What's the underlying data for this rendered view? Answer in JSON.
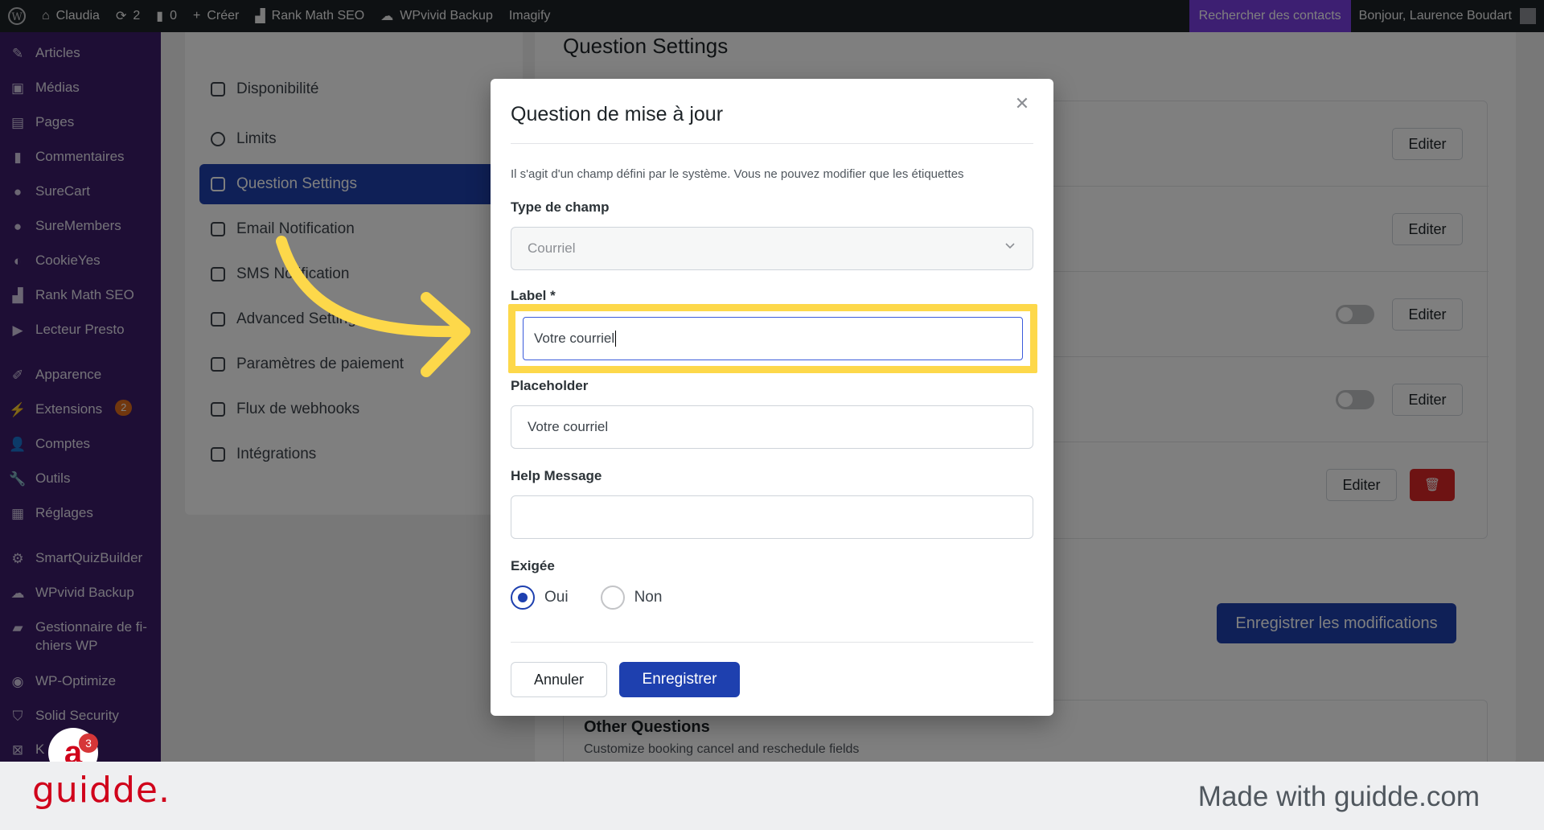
{
  "adminbar": {
    "site_name": "Claudia",
    "updates_count": "2",
    "comments_count": "0",
    "new_label": "Créer",
    "rankmath": "Rank Math SEO",
    "wpvivid": "WPvivid Backup",
    "imagify": "Imagify",
    "contacts": "Rechercher des contacts",
    "greeting": "Bonjour, Laurence Boudart"
  },
  "sidebar": {
    "items": [
      {
        "label": "Articles",
        "icon": "pin-icon"
      },
      {
        "label": "Médias",
        "icon": "media-icon"
      },
      {
        "label": "Pages",
        "icon": "pages-icon"
      },
      {
        "label": "Commentaires",
        "icon": "comment-icon"
      },
      {
        "label": "SureCart",
        "icon": "surecart-icon"
      },
      {
        "label": "SureMembers",
        "icon": "suremembers-icon"
      },
      {
        "label": "CookieYes",
        "icon": "cookie-icon"
      },
      {
        "label": "Rank Math SEO",
        "icon": "rankmath-icon"
      },
      {
        "label": "Lecteur Presto",
        "icon": "presto-icon"
      },
      {
        "label": "Apparence",
        "icon": "brush-icon"
      },
      {
        "label": "Extensions",
        "icon": "plugin-icon",
        "badge": "2"
      },
      {
        "label": "Comptes",
        "icon": "user-icon"
      },
      {
        "label": "Outils",
        "icon": "wrench-icon"
      },
      {
        "label": "Réglages",
        "icon": "settings-icon"
      },
      {
        "label": "SmartQuizBuilder",
        "icon": "gear-icon"
      },
      {
        "label": "WPvivid Backup",
        "icon": "cloud-icon"
      },
      {
        "label": "Gestionnaire de fi-chiers WP",
        "line1": "Gestionnaire de fi-",
        "line2": "chiers WP",
        "icon": "folder-icon"
      },
      {
        "label": "WP-Optimize",
        "icon": "optimize-icon"
      },
      {
        "label": "Solid Security",
        "icon": "shield-icon"
      },
      {
        "label": "K",
        "icon": "k-icon"
      }
    ],
    "guidde_count": "3"
  },
  "settings_nav": {
    "items": [
      {
        "label": "Disponibilité"
      },
      {
        "label": "Limits"
      },
      {
        "label": "Question Settings",
        "active": true
      },
      {
        "label": "Email Notification"
      },
      {
        "label": "SMS Notification"
      },
      {
        "label": "Advanced Settings"
      },
      {
        "label": "Paramètres de paiement"
      },
      {
        "label": "Flux de webhooks"
      },
      {
        "label": "Intégrations"
      }
    ]
  },
  "content": {
    "title": "Question Settings",
    "edit_label": "Editer",
    "save_all": "Enregistrer les modifications",
    "other_title": "Other Questions",
    "other_sub": "Customize booking cancel and reschedule fields"
  },
  "modal": {
    "title": "Question de mise à jour",
    "info": "Il s'agit d'un champ défini par le système. Vous ne pouvez modifier que les étiquettes",
    "type_label": "Type de champ",
    "type_value": "Courriel",
    "label_label": "Label *",
    "label_value": "Votre courriel",
    "placeholder_label": "Placeholder",
    "placeholder_value": "Votre courriel",
    "help_label": "Help Message",
    "help_value": "",
    "required_label": "Exigée",
    "yes": "Oui",
    "no": "Non",
    "required_value": "Oui",
    "cancel": "Annuler",
    "save": "Enregistrer"
  },
  "footer": {
    "logo": "guidde.",
    "made_with": "Made with guidde.com"
  },
  "colors": {
    "sidebar": "#3c1d6b",
    "accent": "#1e40af",
    "highlight": "#fdd84a",
    "brand": "#d0021b"
  }
}
